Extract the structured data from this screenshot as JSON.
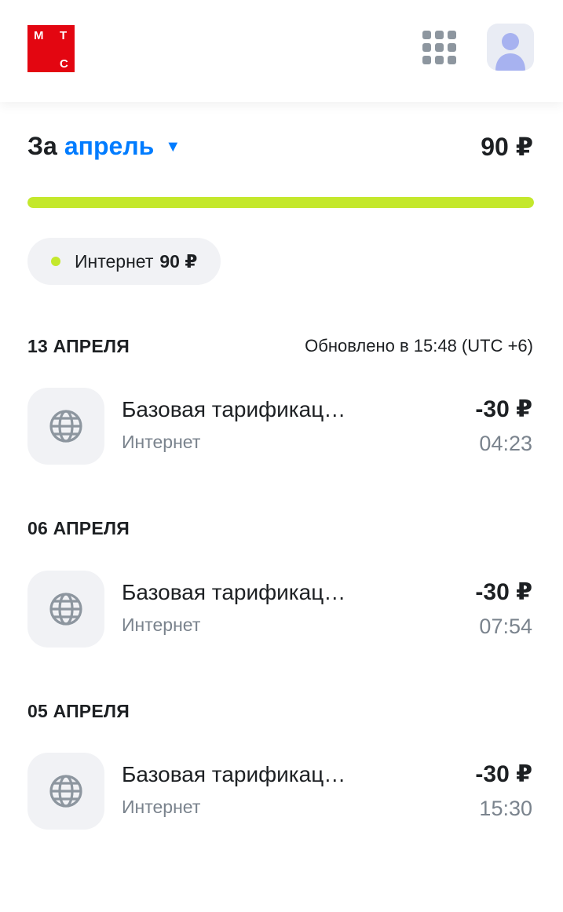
{
  "header": {
    "logo": {
      "letters": [
        "М",
        "Т",
        "С"
      ],
      "color": "#e30611"
    },
    "apps_icon": "grid-icon",
    "avatar_icon": "user-avatar-icon"
  },
  "summary": {
    "period_prefix": "За",
    "period_month": "апрель",
    "period_caret": "▼",
    "total": "90 ₽",
    "progress_fraction": 1.0,
    "progress_color": "#c4e82c"
  },
  "chips": [
    {
      "label": "Интернет",
      "amount": "90 ₽",
      "dot_color": "#c4e82c"
    }
  ],
  "updated": "Обновлено в 15:48 (UTC +6)",
  "groups": [
    {
      "date": "13 АПРЕЛЯ",
      "items": [
        {
          "title": "Базовая тарификация интернета",
          "category": "Интернет",
          "amount": "-30 ₽",
          "time": "04:23",
          "icon": "globe-icon"
        }
      ]
    },
    {
      "date": "06 АПРЕЛЯ",
      "items": [
        {
          "title": "Базовая тарификация интернета",
          "category": "Интернет",
          "amount": "-30 ₽",
          "time": "07:54",
          "icon": "globe-icon"
        }
      ]
    },
    {
      "date": "05 АПРЕЛЯ",
      "items": [
        {
          "title": "Базовая тарификация интернета",
          "category": "Интернет",
          "amount": "-30 ₽",
          "time": "15:30",
          "icon": "globe-icon"
        }
      ]
    }
  ]
}
